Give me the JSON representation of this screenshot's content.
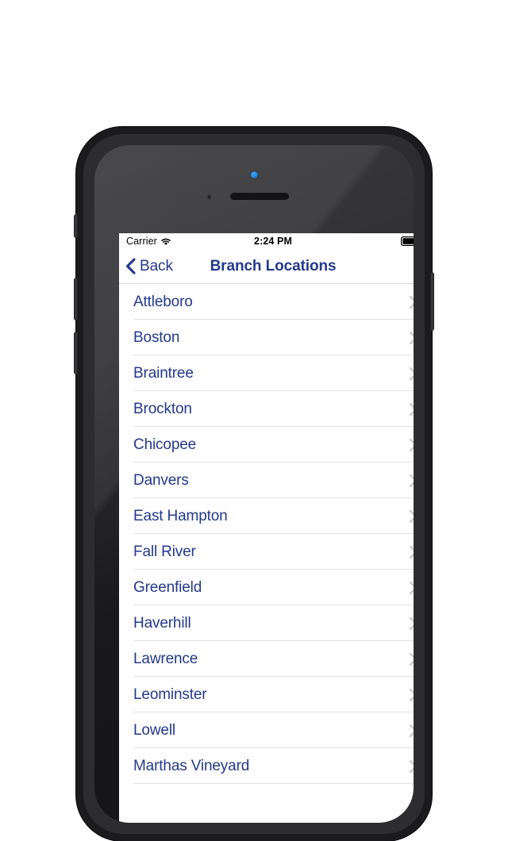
{
  "device": {
    "name": "iphone-mockup",
    "front_camera_icon": "camera-icon",
    "earpiece_icon": "speaker-icon",
    "sensor_icon": "proximity-sensor-icon",
    "buttons": {
      "silent": "silent-switch",
      "volume_up": "volume-up-button",
      "volume_down": "volume-down-button",
      "power": "power-button"
    }
  },
  "status_bar": {
    "carrier": "Carrier",
    "wifi_icon": "wifi-icon",
    "time": "2:24 PM",
    "battery_icon": "battery-full-icon"
  },
  "nav_bar": {
    "back_label": "Back",
    "back_icon": "chevron-left-icon",
    "title": "Branch Locations",
    "accent_color": "#22398c"
  },
  "list": {
    "chevron_icon": "chevron-right-icon",
    "separator_color": "#e2e2e4",
    "text_color": "#22398c",
    "items": [
      {
        "label": "Attleboro"
      },
      {
        "label": "Boston"
      },
      {
        "label": "Braintree"
      },
      {
        "label": "Brockton"
      },
      {
        "label": "Chicopee"
      },
      {
        "label": "Danvers"
      },
      {
        "label": "East Hampton"
      },
      {
        "label": "Fall River"
      },
      {
        "label": "Greenfield"
      },
      {
        "label": "Haverhill"
      },
      {
        "label": "Lawrence"
      },
      {
        "label": "Leominster"
      },
      {
        "label": "Lowell"
      },
      {
        "label": "Marthas Vineyard"
      }
    ]
  }
}
